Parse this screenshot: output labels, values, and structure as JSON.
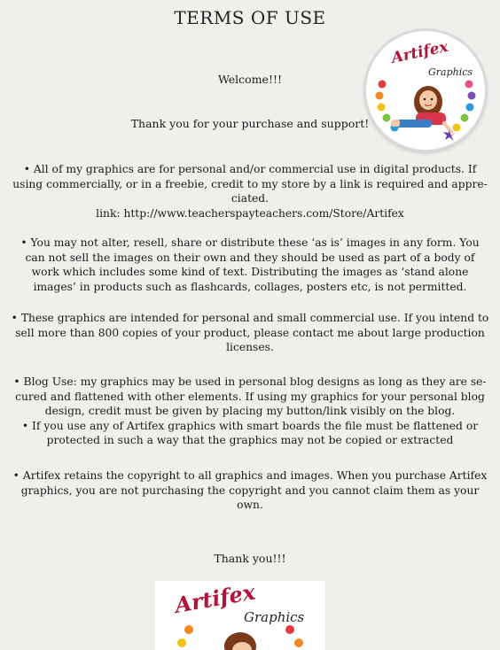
{
  "header": {
    "title": "TERMS OF USE",
    "welcome": "Welcome!!!",
    "thanks": "Thank you for your purchase and support!"
  },
  "terms": [
    {
      "lines": [
        "•   All of my graphics are for personal and/or commercial use in digital products. If",
        "using commercially, or in a freebie, credit to my store by a link is required and appre-",
        "ciated.",
        "link: http://www.teacherspayteachers.com/Store/Artifex"
      ]
    },
    {
      "lines": [
        "•   You may not alter, resell, share or distribute these ‘as is’ images in any form. You",
        "can not sell the images on their own and they should be used as part of a body of",
        "work which includes some kind of text. Distributing the images as ‘stand alone",
        "images’ in products such as flashcards, collages, posters etc, is not permitted."
      ]
    },
    {
      "lines": [
        "• These graphics are intended for personal and small commercial use. If you intend to",
        "sell more than 800 copies of your product, please contact me about large production",
        "licenses."
      ]
    },
    {
      "lines": [
        "•  Blog Use: my graphics may be used in personal blog designs as long as they are se-",
        "cured and flattened with other elements. If using my graphics for your personal blog",
        "design, credit must be given by placing my button/link visibly on the blog.",
        "•   If you use any of Artifex graphics with smart boards the file must be flattened or",
        "protected in such a way that the graphics may not be copied or extracted"
      ]
    },
    {
      "lines": [
        "• Artifex retains the copyright to all graphics and images. When you purchase Artifex",
        "graphics, you are not purchasing the copyright and you cannot claim them as your",
        "own."
      ]
    }
  ],
  "outro": "Thank you!!!",
  "logo": {
    "word1": "Artifex",
    "word2": "Graphics",
    "accent_color": "#b3133a",
    "dot_colors": [
      "#e23b3b",
      "#f08a1e",
      "#f4c21a",
      "#7cc243",
      "#2a9ad8",
      "#7b4fb0",
      "#e94f8a"
    ]
  }
}
